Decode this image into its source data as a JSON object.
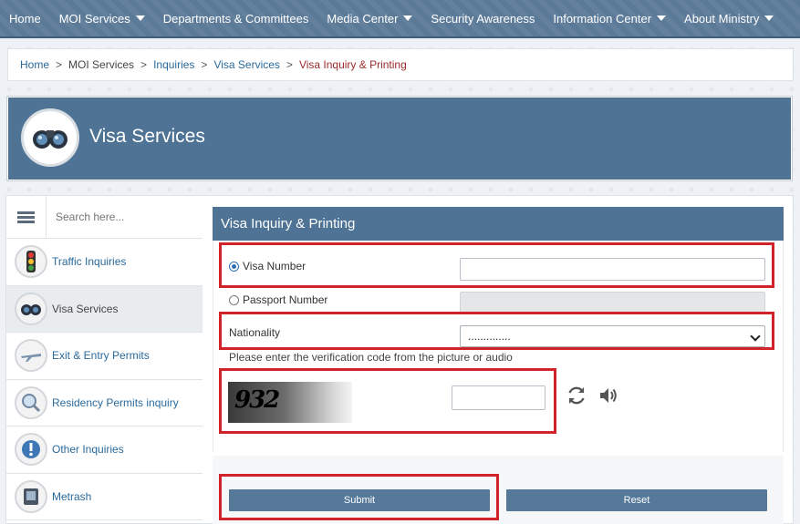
{
  "nav": {
    "items": [
      {
        "label": "Home",
        "dropdown": false
      },
      {
        "label": "MOI Services",
        "dropdown": true
      },
      {
        "label": "Departments & Committees",
        "dropdown": false
      },
      {
        "label": "Media Center",
        "dropdown": true
      },
      {
        "label": "Security Awareness",
        "dropdown": false
      },
      {
        "label": "Information Center",
        "dropdown": true
      },
      {
        "label": "About Ministry",
        "dropdown": true
      }
    ]
  },
  "breadcrumb": {
    "home": "Home",
    "sep": ">",
    "moi": "MOI Services",
    "inquiries": "Inquiries",
    "visa": "Visa Services",
    "current": "Visa Inquiry & Printing"
  },
  "banner": {
    "title": "Visa Services"
  },
  "sidebar": {
    "search_placeholder": "Search here...",
    "items": [
      {
        "label": "Traffic Inquiries",
        "icon": "traffic-light-icon"
      },
      {
        "label": "Visa Services",
        "icon": "binoculars-icon"
      },
      {
        "label": "Exit & Entry Permits",
        "icon": "airplane-icon"
      },
      {
        "label": "Residency Permits inquiry",
        "icon": "magnifier-icon"
      },
      {
        "label": "Other Inquiries",
        "icon": "info-icon"
      },
      {
        "label": "Metrash",
        "icon": "device-icon"
      }
    ]
  },
  "form": {
    "title": "Visa Inquiry & Printing",
    "visa_number_label": "Visa Number",
    "passport_number_label": "Passport Number",
    "nationality_label": "Nationality",
    "nationality_value": "..............",
    "verification_hint": "Please enter the verification code from the picture or audio",
    "captcha_text": "932",
    "submit_label": "Submit",
    "reset_label": "Reset"
  },
  "colors": {
    "nav": "#5b7a98",
    "panel": "#4e7394",
    "highlight": "#d2232a",
    "button": "#56799a"
  }
}
